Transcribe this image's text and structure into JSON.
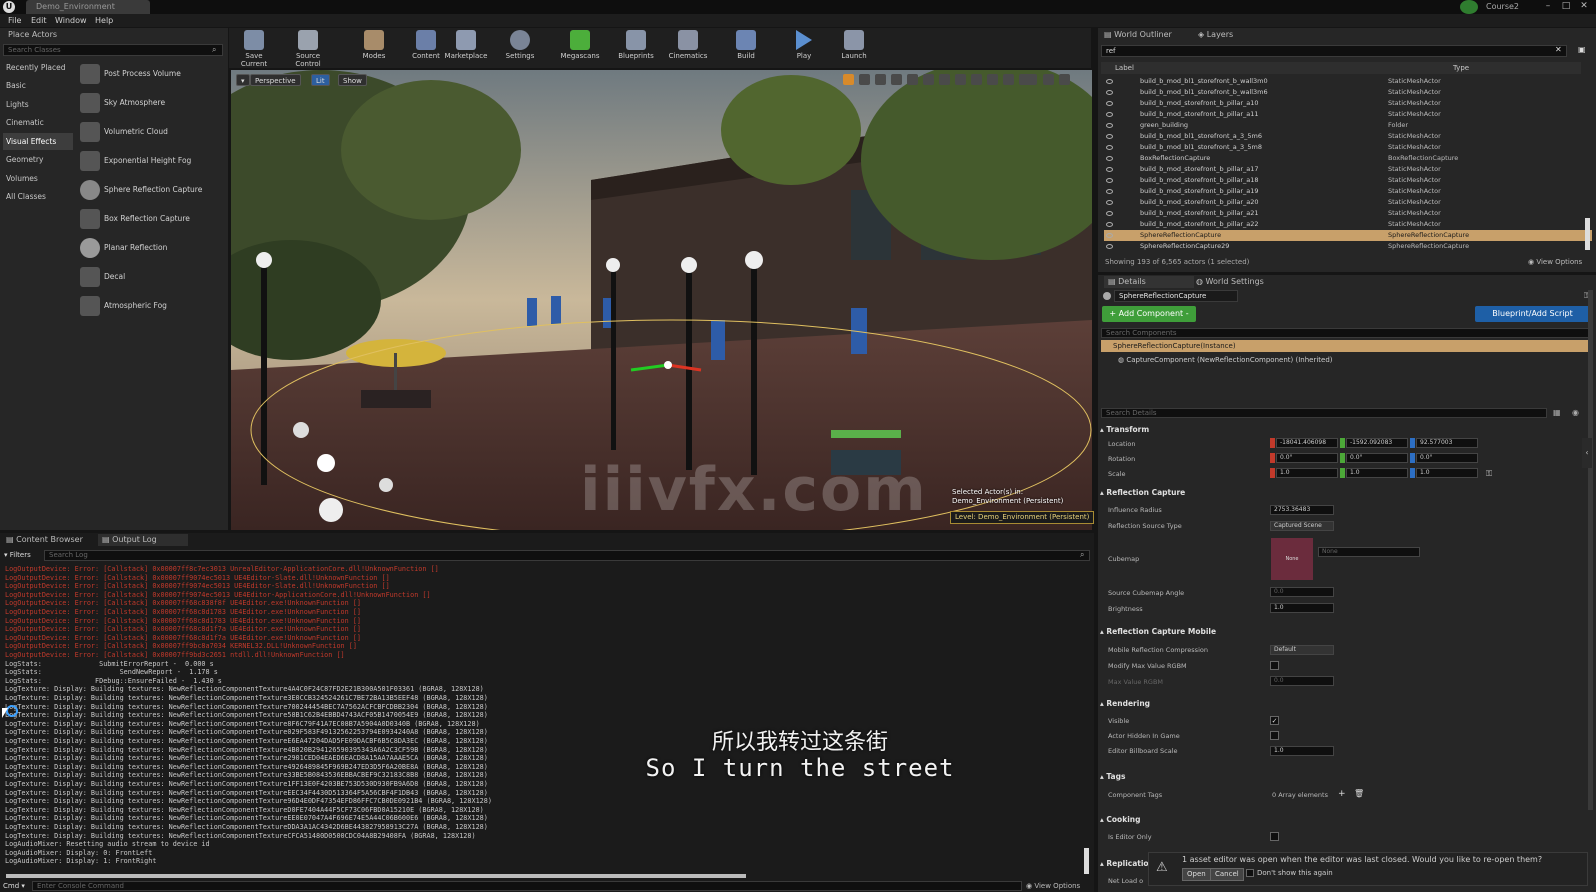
{
  "window": {
    "doc_tab": "Demo_Environment",
    "project": "Course2"
  },
  "menu": [
    "File",
    "Edit",
    "Window",
    "Help"
  ],
  "place_actors": {
    "tab": "Place Actors",
    "search_placeholder": "Search Classes",
    "categories": [
      "Recently Placed",
      "Basic",
      "Lights",
      "Cinematic",
      "Visual Effects",
      "Geometry",
      "Volumes",
      "All Classes"
    ],
    "active_category": "Visual Effects",
    "items": [
      "Post Process Volume",
      "Sky Atmosphere",
      "Volumetric Cloud",
      "Exponential Height Fog",
      "Sphere Reflection Capture",
      "Box Reflection Capture",
      "Planar Reflection",
      "Decal",
      "Atmospheric Fog"
    ]
  },
  "toolbar": [
    "Save Current",
    "Source Control",
    "Modes",
    "Content",
    "Marketplace",
    "Settings",
    "Megascans",
    "Blueprints",
    "Cinematics",
    "Build",
    "Play",
    "Launch"
  ],
  "viewport": {
    "buttons": [
      "Perspective",
      "Lit",
      "Show"
    ],
    "selected_actor": "Selected Actor(s) in:",
    "selected_level": "Demo_Environment (Persistent)",
    "level_label": "Level: Demo_Environment (Persistent)",
    "watermark": "iiivfx.com"
  },
  "outliner": {
    "tabs": [
      "World Outliner",
      "Layers"
    ],
    "search_value": "ref",
    "col_label": "Label",
    "col_type": "Type",
    "rows": [
      {
        "name": "build_b_mod_bl1_storefront_b_wall3m0",
        "type": "StaticMeshActor"
      },
      {
        "name": "build_b_mod_bl1_storefront_b_wall3m6",
        "type": "StaticMeshActor"
      },
      {
        "name": "build_b_mod_storefront_b_pillar_a10",
        "type": "StaticMeshActor"
      },
      {
        "name": "build_b_mod_storefront_b_pillar_a11",
        "type": "StaticMeshActor"
      },
      {
        "name": "green_building",
        "type": "Folder"
      },
      {
        "name": "build_b_mod_bl1_storefront_a_3_5m6",
        "type": "StaticMeshActor"
      },
      {
        "name": "build_b_mod_bl1_storefront_a_3_5m8",
        "type": "StaticMeshActor"
      },
      {
        "name": "BoxReflectionCapture",
        "type": "BoxReflectionCapture"
      },
      {
        "name": "build_b_mod_storefront_b_pillar_a17",
        "type": "StaticMeshActor"
      },
      {
        "name": "build_b_mod_storefront_b_pillar_a18",
        "type": "StaticMeshActor"
      },
      {
        "name": "build_b_mod_storefront_b_pillar_a19",
        "type": "StaticMeshActor"
      },
      {
        "name": "build_b_mod_storefront_b_pillar_a20",
        "type": "StaticMeshActor"
      },
      {
        "name": "build_b_mod_storefront_b_pillar_a21",
        "type": "StaticMeshActor"
      },
      {
        "name": "build_b_mod_storefront_b_pillar_a22",
        "type": "StaticMeshActor"
      },
      {
        "name": "SphereReflectionCapture",
        "type": "SphereReflectionCapture"
      },
      {
        "name": "SphereReflectionCapture29",
        "type": "SphereReflectionCapture"
      }
    ],
    "status": "Showing 193 of 6,565 actors (1 selected)",
    "view_options": "View Options"
  },
  "details": {
    "tabs": [
      "Details",
      "World Settings"
    ],
    "actor_name": "SphereReflectionCapture",
    "add_component": "+ Add Component -",
    "blueprint": "Blueprint/Add Script",
    "search_components": "Search Components",
    "instance": "SphereReflectionCapture(Instance)",
    "component": "CaptureComponent (NewReflectionComponent) (Inherited)",
    "search_details": "Search Details",
    "transform": {
      "title": "Transform",
      "location_label": "Location",
      "rotation_label": "Rotation",
      "scale_label": "Scale",
      "location": [
        "-18041.406098",
        "-1592.092083",
        "92.577003"
      ],
      "rotation": [
        "0.0°",
        "0.0°",
        "0.0°"
      ],
      "scale": [
        "1.0",
        "1.0",
        "1.0"
      ]
    },
    "reflection_capture": {
      "title": "Reflection Capture",
      "influence_radius_label": "Influence Radius",
      "influence_radius": "2753.36483",
      "source_type_label": "Reflection Source Type",
      "source_type": "Captured Scene",
      "cubemap_label": "Cubemap",
      "cubemap_value": "None",
      "cubemap_thumb": "None",
      "source_angle_label": "Source Cubemap Angle",
      "source_angle": "0.0",
      "brightness_label": "Brightness",
      "brightness": "1.0"
    },
    "mobile": {
      "title": "Reflection Capture Mobile",
      "compression_label": "Mobile Reflection Compression",
      "compression": "Default",
      "modify_label": "Modify Max Value RGBM",
      "max_label": "Max Value RGBM",
      "max_value": "0.0"
    },
    "rendering": {
      "title": "Rendering",
      "visible_label": "Visible",
      "hidden_label": "Actor Hidden In Game",
      "billboard_label": "Editor Billboard Scale",
      "billboard": "1.0"
    },
    "tags": {
      "title": "Tags",
      "component_tags_label": "Component Tags",
      "elements": "0 Array elements"
    },
    "cooking": {
      "title": "Cooking",
      "editor_only_label": "Is Editor Only"
    },
    "replication": {
      "title": "Replication",
      "net_load_label": "Net Load o"
    }
  },
  "bottom": {
    "tabs": [
      "Content Browser",
      "Output Log"
    ],
    "filters": "Filters",
    "search_placeholder": "Search Log",
    "cmd": "Cmd",
    "console_placeholder": "Enter Console Command",
    "view_options": "View Options"
  },
  "log_lines": [
    {
      "text": "LogOutputDevice: Error: [Callstack] 0x00007ff8c7ec3013 UnrealEditor-ApplicationCore.dll!UnknownFunction []",
      "kind": "err"
    },
    {
      "text": "LogOutputDevice: Error: [Callstack] 0x00007ff9074ec5013 UE4Editor-Slate.dll!UnknownFunction []",
      "kind": "err"
    },
    {
      "text": "LogOutputDevice: Error: [Callstack] 0x00007ff9074ec5013 UE4Editor-Slate.dll!UnknownFunction []",
      "kind": "err"
    },
    {
      "text": "LogOutputDevice: Error: [Callstack] 0x00007ff9074ec5013 UE4Editor-ApplicationCore.dll!UnknownFunction []",
      "kind": "err"
    },
    {
      "text": "LogOutputDevice: Error: [Callstack] 0x00007ff68c838f8f UE4Editor.exe!UnknownFunction []",
      "kind": "err"
    },
    {
      "text": "LogOutputDevice: Error: [Callstack] 0x00007ff68c8d1783 UE4Editor.exe!UnknownFunction []",
      "kind": "err"
    },
    {
      "text": "LogOutputDevice: Error: [Callstack] 0x00007ff68c8d1783 UE4Editor.exe!UnknownFunction []",
      "kind": "err"
    },
    {
      "text": "LogOutputDevice: Error: [Callstack] 0x00007ff68c8d1f7a UE4Editor.exe!UnknownFunction []",
      "kind": "err"
    },
    {
      "text": "LogOutputDevice: Error: [Callstack] 0x00007ff68c8d1f7a UE4Editor.exe!UnknownFunction []",
      "kind": "err"
    },
    {
      "text": "LogOutputDevice: Error: [Callstack] 0x00007ff9bc8a7034 KERNEL32.DLL!UnknownFunction []",
      "kind": "err"
    },
    {
      "text": "LogOutputDevice: Error: [Callstack] 0x00007ff9bd3c2651 ntdll.dll!UnknownFunction []",
      "kind": "err"
    },
    {
      "text": "LogStats:              SubmitErrorReport -  0.000 s",
      "kind": "info"
    },
    {
      "text": "LogStats:                   SendNewReport -  1.178 s",
      "kind": "info"
    },
    {
      "text": "LogStats:             FDebug::EnsureFailed -  1.430 s",
      "kind": "info"
    },
    {
      "text": "LogTexture: Display: Building textures: NewReflectionComponentTexture4A4C0F24C87FD2E21B300A501F03361 (BGRA8, 128X128)",
      "kind": "info"
    },
    {
      "text": "LogTexture: Display: Building textures: NewReflectionComponentTexture3E0CCB324524261C7BE72BA13B5EEF48 (BGRA8, 128X128)",
      "kind": "info"
    },
    {
      "text": "LogTexture: Display: Building textures: NewReflectionComponentTexture700244454BEC7A7562ACFCBFCDBB2304 (BGRA8, 128X128)",
      "kind": "info"
    },
    {
      "text": "LogTexture: Display: Building textures: NewReflectionComponentTexture58B1C62B4EBBD4743ACF05B1470054E9 (BGRA8, 128X128)",
      "kind": "info"
    },
    {
      "text": "LogTexture: Display: Building textures: NewReflectionComponentTexture8F6C79F41A7EC08B7A5904A0D0340B (BGRA8, 128X128)",
      "kind": "info"
    },
    {
      "text": "LogTexture: Display: Building textures: NewReflectionComponentTexture029F583F49132562253794E0934240A8 (BGRA8, 128X128)",
      "kind": "info"
    },
    {
      "text": "LogTexture: Display: Building textures: NewReflectionComponentTextureE6EA47204DAD5FE09DACBF6B5C8DA3EC (BGRA8, 128X128)",
      "kind": "info"
    },
    {
      "text": "LogTexture: Display: Building textures: NewReflectionComponentTexture4B020B294126590395343A6A2C3CF59B (BGRA8, 128X128)",
      "kind": "info"
    },
    {
      "text": "LogTexture: Display: Building textures: NewReflectionComponentTexture2901CED04EAED6EACD8A15AA7AAAE5CA (BGRA8, 128X128)",
      "kind": "info"
    },
    {
      "text": "LogTexture: Display: Building textures: NewReflectionComponentTexture4926489845F969B247ED3D5F6A20BE8A (BGRA8, 128X128)",
      "kind": "info"
    },
    {
      "text": "LogTexture: Display: Building textures: NewReflectionComponentTexture33BE5B0843536EBBACBEF9C32183C8B8 (BGRA8, 128X128)",
      "kind": "info"
    },
    {
      "text": "LogTexture: Display: Building textures: NewReflectionComponentTexture1FF13E0F4203BE753D530D930FB9A6D8 (BGRA8, 128X128)",
      "kind": "info"
    },
    {
      "text": "LogTexture: Display: Building textures: NewReflectionComponentTextureEEC34F4430D513364F5A56CBF4F1DB43 (BGRA8, 128X128)",
      "kind": "info"
    },
    {
      "text": "LogTexture: Display: Building textures: NewReflectionComponentTexture96D4E0DF47354EFD86FFC7CB0DE0921B4 (BGRA8, 128X128)",
      "kind": "info"
    },
    {
      "text": "LogTexture: Display: Building textures: NewReflectionComponentTextureD0FE7404A44F5CF73C06FBD0A15210E (BGRA8, 128X128)",
      "kind": "info"
    },
    {
      "text": "LogTexture: Display: Building textures: NewReflectionComponentTextureEE0E07047A4F696E74E5A44C06B600E6 (BGRA8, 128X128)",
      "kind": "info"
    },
    {
      "text": "LogTexture: Display: Building textures: NewReflectionComponentTextureDDA3A1AC4342D6BE443827958913C27A (BGRA8, 128X128)",
      "kind": "info"
    },
    {
      "text": "LogTexture: Display: Building textures: NewReflectionComponentTextureCFCA51480D0500CDC04A8B29408FA (BGRA8, 128X128)",
      "kind": "info"
    },
    {
      "text": "LogAudioMixer: Resetting audio stream to device id",
      "kind": "info"
    },
    {
      "text": "LogAudioMixer: Display: 0: FrontLeft",
      "kind": "info"
    },
    {
      "text": "LogAudioMixer: Display: 1: FrontRight",
      "kind": "info"
    }
  ],
  "subtitle": {
    "cn": "所以我转过这条街",
    "en": "So I turn the street"
  },
  "notification": {
    "text": "1 asset editor was open when the editor was last closed. Would you like to re-open them?",
    "open": "Open",
    "cancel": "Cancel",
    "dont_show": "Don't show this again"
  },
  "colors": {
    "panel": "#262626",
    "selection": "#c8a06a",
    "accent_blue": "#1e5fa6",
    "accent_green": "#3f9e3a",
    "log_error": "#c0392b",
    "log_info": "#c8c8c8"
  }
}
